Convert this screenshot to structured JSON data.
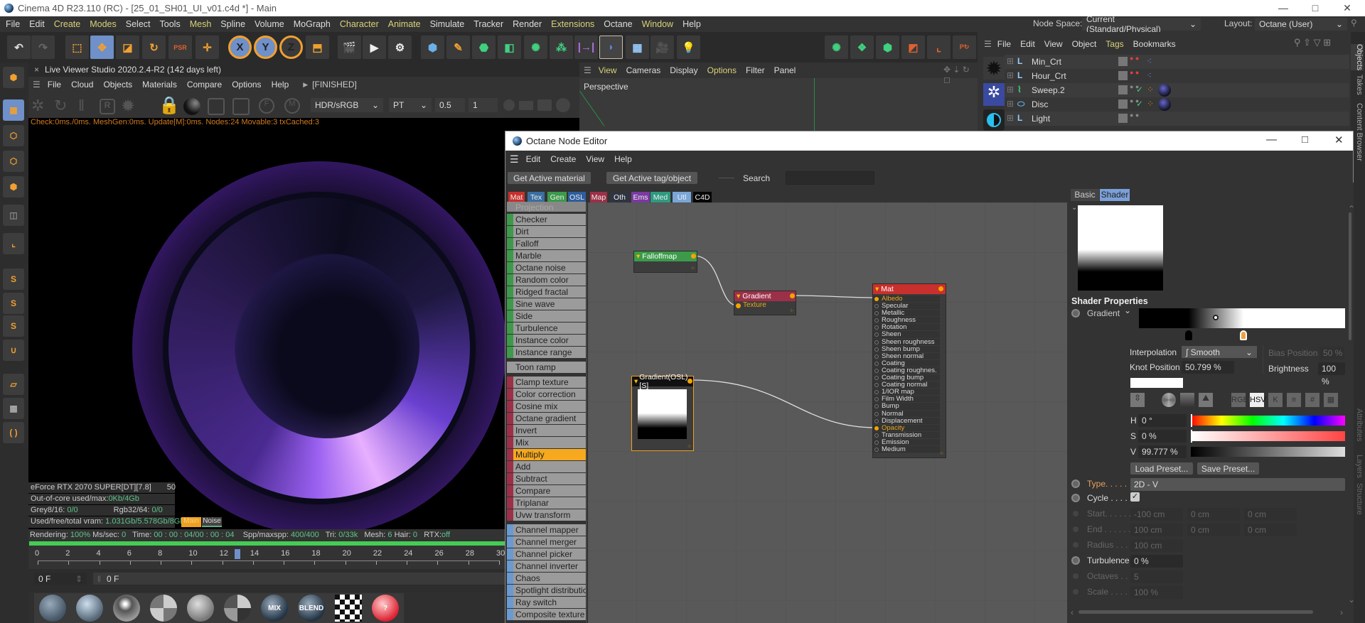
{
  "window": {
    "title": "Cinema 4D R23.110 (RC) - [25_01_SH01_UI_v01.c4d *] - Main",
    "minimize": "—",
    "maximize": "□",
    "close": "✕"
  },
  "menu": [
    {
      "label": "File"
    },
    {
      "label": "Edit"
    },
    {
      "label": "Create",
      "hl": true
    },
    {
      "label": "Modes",
      "hl": true
    },
    {
      "label": "Select"
    },
    {
      "label": "Tools"
    },
    {
      "label": "Mesh",
      "hl": true
    },
    {
      "label": "Spline"
    },
    {
      "label": "Volume"
    },
    {
      "label": "MoGraph"
    },
    {
      "label": "Character",
      "hl": true
    },
    {
      "label": "Animate",
      "hl": true
    },
    {
      "label": "Simulate"
    },
    {
      "label": "Tracker"
    },
    {
      "label": "Render"
    },
    {
      "label": "Extensions",
      "hl": true
    },
    {
      "label": "Octane"
    },
    {
      "label": "Window",
      "hl": true
    },
    {
      "label": "Help"
    }
  ],
  "node_space": {
    "label": "Node Space:",
    "value": "Current (Standard/Physical)"
  },
  "layout": {
    "label": "Layout:",
    "value": "Octane (User)"
  },
  "toolbar": {
    "axis_x": "X",
    "axis_y": "Y",
    "axis_z": "Z",
    "psr": "PSR"
  },
  "live_viewer": {
    "title": "Live Viewer Studio 2020.2.4-R2 (142 days left)",
    "close": "×",
    "menu": [
      "File",
      "Cloud",
      "Objects",
      "Materials",
      "Compare",
      "Options",
      "Help"
    ],
    "state": "[FINISHED]",
    "color_space": "HDR/sRGB",
    "kernel": "PT",
    "value1": "0.5",
    "value2": "1",
    "status": "Check:0ms./0ms. MeshGen:0ms. Update[M]:0ms. Nodes:24 Movable:3 txCached:3",
    "gpu": "eForce RTX 2070 SUPER[DT][7.8]",
    "gpu_value": "50",
    "out_of_core_label": "Out-of-core used/max:",
    "out_of_core": "0Kb/4Gb",
    "grey_label": "Grey8/16:",
    "grey": "0/0",
    "rgb_label": "Rgb32/64:",
    "rgb": "0/0",
    "vram_label": "Used/free/total vram:",
    "vram": "1.031Gb/5.578Gb/8Gb",
    "tab_main": "Main",
    "tab_noise": "Noise",
    "rendering_label": "Rendering:",
    "rendering": "100%",
    "mssec_label": "Ms/sec:",
    "mssec": "0",
    "time_label": "Time:",
    "time": "00 : 00 : 04/00 : 00 : 04",
    "spp_label": "Spp/maxspp:",
    "spp": "400/400",
    "tri_label": "Tri:",
    "tri": "0/33k",
    "mesh_label": "Mesh:",
    "mesh": "6",
    "hair_label": "Hair:",
    "hair": "0",
    "rtx_label": "RTX:",
    "rtx": "off",
    "progress": 1.0
  },
  "timeline": {
    "labels": [
      "0",
      "2",
      "4",
      "6",
      "8",
      "10",
      "12",
      "14",
      "16",
      "18",
      "20",
      "22",
      "24",
      "26",
      "28",
      "30"
    ],
    "current_frame": 13,
    "start_field": "0 F",
    "current_field": "0 F"
  },
  "materials": [
    "metal",
    "glass",
    "chrome",
    "checker-ball",
    "diffuse",
    "specular",
    "MIX",
    "BLEND",
    "checker",
    "missing"
  ],
  "viewport": {
    "menu": [
      {
        "label": "View",
        "hl": true
      },
      {
        "label": "Cameras"
      },
      {
        "label": "Display"
      },
      {
        "label": "Options",
        "hl": true
      },
      {
        "label": "Filter"
      },
      {
        "label": "Panel"
      }
    ],
    "camera": "Perspective"
  },
  "object_manager": {
    "menu": [
      {
        "label": "File"
      },
      {
        "label": "Edit"
      },
      {
        "label": "View"
      },
      {
        "label": "Object"
      },
      {
        "label": "Tags",
        "hl": true
      },
      {
        "label": "Bookmarks"
      }
    ],
    "objects": [
      {
        "name": "Min_Crt",
        "type": "null"
      },
      {
        "name": "Hour_Crt",
        "type": "null"
      },
      {
        "name": "Sweep.2",
        "type": "sweep",
        "check": true
      },
      {
        "name": "Disc",
        "type": "disc",
        "check": true
      },
      {
        "name": "Light",
        "type": "null"
      }
    ],
    "tabs": [
      "Objects",
      "Takes",
      "Content Browser"
    ],
    "lower_tabs": [
      "Attributes",
      "Layers",
      "Structure"
    ]
  },
  "node_editor": {
    "title": "Octane Node Editor",
    "menu": [
      "Edit",
      "Create",
      "View",
      "Help"
    ],
    "get_material": "Get Active material",
    "get_tag": "Get Active tag/object",
    "search_label": "Search",
    "search_value": "",
    "categories": [
      {
        "label": "Mat",
        "color": "#c8302e"
      },
      {
        "label": "Tex",
        "color": "#3a6ea0"
      },
      {
        "label": "Gen",
        "color": "#3c9a4a"
      },
      {
        "label": "OSL",
        "color": "#2f5e9e"
      },
      {
        "label": "Map",
        "color": "#9c3048"
      },
      {
        "label": "Oth",
        "color": "#2e3440"
      },
      {
        "label": "Ems",
        "color": "#7a3aa0"
      },
      {
        "label": "Med",
        "color": "#2e9a80"
      },
      {
        "label": "Utl",
        "color": "#7aa6d8"
      },
      {
        "label": "C4D",
        "color": "#050505"
      }
    ],
    "list_partial": "Projection",
    "list_groups": [
      {
        "color": "#3c9a4a",
        "items": [
          "Checker",
          "Dirt",
          "Falloff",
          "Marble",
          "Octane noise",
          "Random color",
          "Ridged fractal",
          "Sine wave",
          "Side",
          "Turbulence",
          "Instance color",
          "Instance range"
        ]
      },
      {
        "color": "#9b9b9b",
        "items": [
          "Toon ramp"
        ]
      },
      {
        "color": "#9c3048",
        "items": [
          "Clamp texture",
          "Color correction",
          "Cosine mix",
          "Octane gradient",
          "Invert",
          "Mix",
          "Multiply",
          "Add",
          "Subtract",
          "Compare",
          "Triplanar",
          "Uvw transform"
        ],
        "selected": "Multiply"
      },
      {
        "color": "#6a9ad0",
        "items": [
          "Channel mapper",
          "Channel merger",
          "Channel picker",
          "Channel inverter",
          "Chaos",
          "Spotlight distribution",
          "Ray switch",
          "Composite texture"
        ]
      }
    ],
    "nodes": {
      "falloff": "Falloffmap",
      "gradient": "Gradient",
      "gradient_input": "Texture",
      "osl": "Gradient(OSL)[S]",
      "mat": "Mat",
      "mat_ports": [
        "Albedo",
        "Specular",
        "Metallic",
        "Roughness",
        "Rotation",
        "Sheen",
        "Sheen roughness",
        "Sheen bump",
        "Sheen normal",
        "Coating",
        "Coating roughnes.",
        "Coating bump",
        "Coating normal",
        "1/IOR map",
        "Film Width",
        "Bump",
        "Normal",
        "Displacement",
        "Opacity",
        "Transmission",
        "Emission",
        "Medium"
      ],
      "connected_ports": [
        "Albedo",
        "Opacity"
      ]
    },
    "props": {
      "tab_basic": "Basic",
      "tab_shader": "Shader",
      "section": "Shader Properties",
      "gradient_label": "Gradient",
      "knots": [
        {
          "position": 0.24,
          "color": "#000000"
        },
        {
          "position": 0.508,
          "color": "#ffffff"
        }
      ],
      "interpolation_label": "Interpolation",
      "interpolation": "Smooth",
      "bias_label": "Bias Position",
      "bias": "50 %",
      "knot_label": "Knot Position",
      "knot": "50.799 %",
      "brightness_label": "Brightness",
      "brightness": "100 %",
      "color_modes": [
        "RGB",
        "HSV",
        "K",
        "≡",
        "#",
        "▦"
      ],
      "active_mode": "HSV",
      "h_label": "H",
      "h": "0 °",
      "s_label": "S",
      "s": "0 %",
      "v_label": "V",
      "v": "99.777 %",
      "load_preset": "Load Preset...",
      "save_preset": "Save Preset...",
      "type_label": "Type. . . . .",
      "type": "2D - V",
      "cycle_label": "Cycle . . . . .",
      "cycle": true,
      "start_label": "Start. . . . . .",
      "start": [
        "-100 cm",
        "0 cm",
        "0 cm"
      ],
      "end_label": "End . . . . . .",
      "end": [
        "100 cm",
        "0 cm",
        "0 cm"
      ],
      "radius_label": "Radius . . . .",
      "radius": "100 cm",
      "turbulence_label": "Turbulence",
      "turbulence": "0 %",
      "octaves_label": "Octaves . . .",
      "octaves": "5",
      "scale_label": "Scale . . . . .",
      "scale": "100 %"
    }
  }
}
